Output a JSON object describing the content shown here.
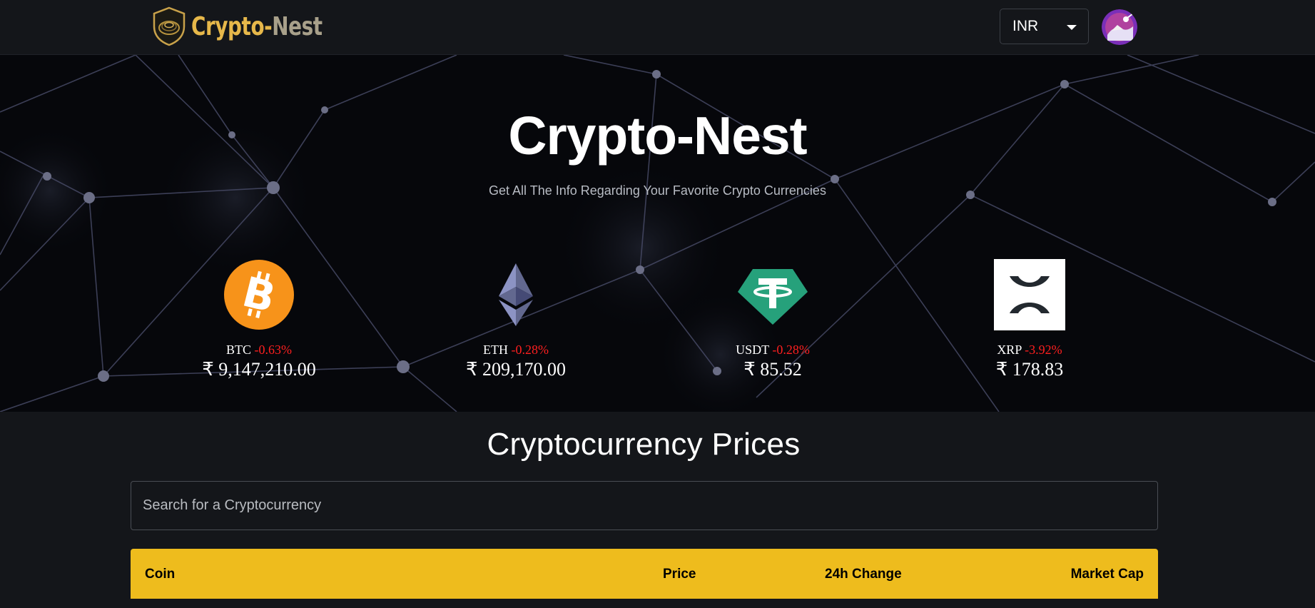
{
  "header": {
    "brand_primary": "Crypto-",
    "brand_secondary": "Nest",
    "currency_selected": "INR",
    "logo_icon": "nest-shield-logo",
    "avatar_icon": "user-avatar"
  },
  "hero": {
    "title": "Crypto-Nest",
    "subtitle": "Get All The Info Regarding Your Favorite Crypto Currencies"
  },
  "trending": [
    {
      "symbol": "BTC",
      "change": "-0.63%",
      "price": "₹ 9,147,210.00",
      "icon": "bitcoin-icon"
    },
    {
      "symbol": "ETH",
      "change": "-0.28%",
      "price": "₹ 209,170.00",
      "icon": "ethereum-icon"
    },
    {
      "symbol": "USDT",
      "change": "-0.28%",
      "price": "₹ 85.52",
      "icon": "tether-icon"
    },
    {
      "symbol": "XRP",
      "change": "-3.92%",
      "price": "₹ 178.83",
      "icon": "xrp-icon"
    }
  ],
  "prices": {
    "title": "Cryptocurrency Prices",
    "search_placeholder": "Search for a Cryptocurrency",
    "columns": [
      "Coin",
      "Price",
      "24h Change",
      "Market Cap"
    ]
  },
  "colors": {
    "background": "#14161a",
    "accent": "#eebc1d",
    "negative": "#ff1f1f",
    "bitcoin": "#f7931a",
    "tether": "#26a17b"
  }
}
